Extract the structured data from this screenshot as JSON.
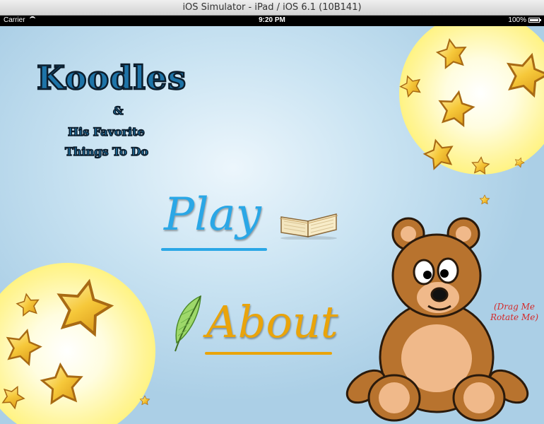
{
  "window": {
    "title": "iOS Simulator - iPad / iOS 6.1 (10B141)"
  },
  "statusbar": {
    "carrier": "Carrier",
    "time": "9:20 PM",
    "battery": "100%"
  },
  "app": {
    "title": "Koodles",
    "ampersand": "&",
    "subtitle_line1": "His Favorite",
    "subtitle_line2": "Things To Do",
    "play_label": "Play",
    "about_label": "About",
    "bear_hint_line1": "(Drag Me",
    "bear_hint_line2": "Rotate Me)"
  },
  "icons": [
    "book-icon",
    "feather-icon",
    "teddy-bear",
    "star-icon",
    "wifi-icon",
    "battery-icon"
  ],
  "colors": {
    "play": "#2aa7e6",
    "about": "#e9a40b",
    "title": "#1e74a8",
    "hint": "#d42a2a",
    "background": "#c9e3f2"
  }
}
